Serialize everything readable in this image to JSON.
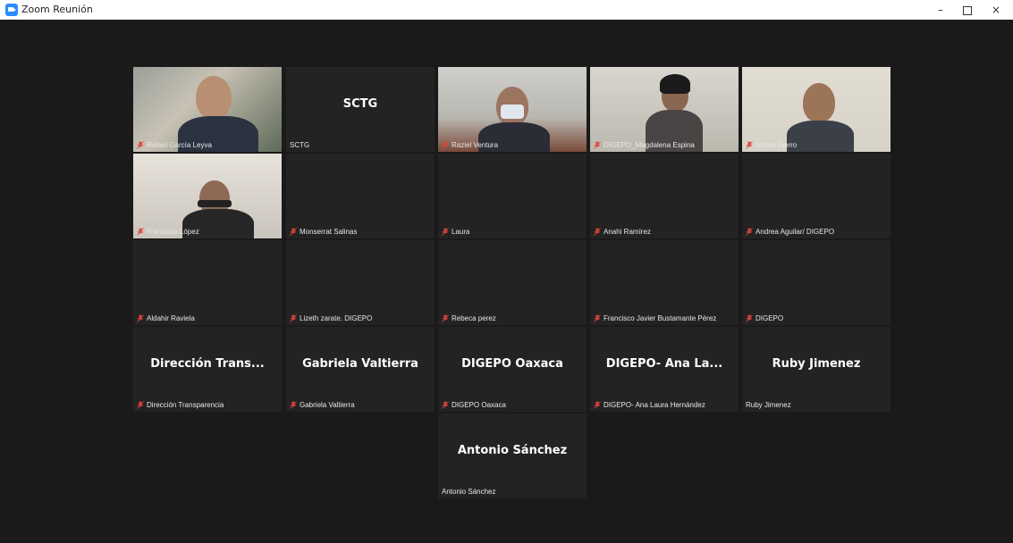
{
  "window": {
    "title": "Zoom Reunión",
    "minimize_glyph": "–",
    "close_glyph": "×"
  },
  "tiles": [
    {
      "name": "Rafael García Leyva",
      "center": "",
      "muted": true,
      "video": true,
      "active": true
    },
    {
      "name": "SCTG",
      "center": "SCTG",
      "muted": false,
      "video": false
    },
    {
      "name": "Raziel Ventura",
      "center": "",
      "muted": true,
      "video": true
    },
    {
      "name": "DIGEPO_Magdalena Espina",
      "center": "",
      "muted": true,
      "video": true
    },
    {
      "name": "Adrian Fierro",
      "center": "",
      "muted": true,
      "video": true
    },
    {
      "name": "Francisco López",
      "center": "",
      "muted": true,
      "video": true
    },
    {
      "name": "Monserrat Salinas",
      "center": "",
      "muted": true,
      "video": false
    },
    {
      "name": "Laura",
      "center": "",
      "muted": true,
      "video": false
    },
    {
      "name": "Anahi Ramírez",
      "center": "",
      "muted": true,
      "video": false
    },
    {
      "name": "Andrea Aguilar/ DIGEPO",
      "center": "",
      "muted": true,
      "video": false
    },
    {
      "name": "Aldahir Raviela",
      "center": "",
      "muted": true,
      "video": false
    },
    {
      "name": "Lizeth zarate. DIGEPO",
      "center": "",
      "muted": true,
      "video": false
    },
    {
      "name": "Rebeca perez",
      "center": "",
      "muted": true,
      "video": false
    },
    {
      "name": "Francisco Javier Bustamante Pérez",
      "center": "",
      "muted": true,
      "video": false
    },
    {
      "name": "DIGEPO",
      "center": "",
      "muted": true,
      "video": false
    },
    {
      "name": "Dirección Transparencia",
      "center": "Dirección Trans...",
      "muted": true,
      "video": false
    },
    {
      "name": "Gabriela Valtierra",
      "center": "Gabriela Valtierra",
      "muted": true,
      "video": false
    },
    {
      "name": "DIGEPO Oaxaca",
      "center": "DIGEPO Oaxaca",
      "muted": true,
      "video": false
    },
    {
      "name": "DIGEPO- Ana Laura Hernández",
      "center": "DIGEPO- Ana La...",
      "muted": true,
      "video": false
    },
    {
      "name": "Ruby Jimenez",
      "center": "Ruby Jimenez",
      "muted": false,
      "video": false
    },
    {
      "name": "Antonio Sánchez",
      "center": "Antonio Sánchez",
      "muted": false,
      "video": false
    }
  ],
  "colors": {
    "active_border": "#c9d84e",
    "muted_icon": "#e0443a",
    "tile_bg": "#232323",
    "stage_bg": "#1a1a1a"
  },
  "icons": {
    "app": "zoom-app-icon",
    "muted": "muted-microphone-icon"
  }
}
